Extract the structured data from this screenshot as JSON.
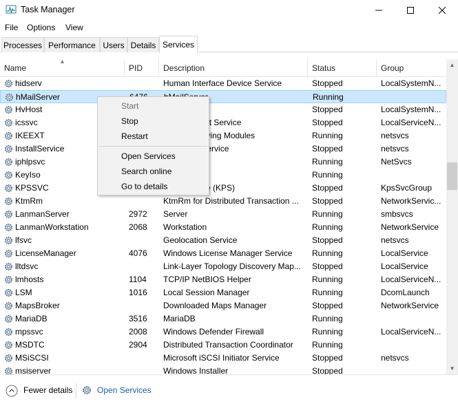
{
  "window": {
    "title": "Task Manager"
  },
  "menu": [
    "File",
    "Options",
    "View"
  ],
  "tabs": [
    "Processes",
    "Performance",
    "Users",
    "Details",
    "Services"
  ],
  "active_tab": "Services",
  "columns": {
    "name": "Name",
    "pid": "PID",
    "description": "Description",
    "status": "Status",
    "group": "Group"
  },
  "rows": [
    {
      "name": "hidserv",
      "pid": "",
      "description": "Human Interface Device Service",
      "status": "Stopped",
      "group": "LocalSystemN..."
    },
    {
      "name": "hMailServer",
      "pid": "6476",
      "description": "hMailServer",
      "status": "Running",
      "group": ""
    },
    {
      "name": "HvHost",
      "pid": "",
      "description": "vice",
      "status": "Stopped",
      "group": "LocalSystemN..."
    },
    {
      "name": "icssvc",
      "pid": "",
      "description": "obile Hotspot Service",
      "status": "Stopped",
      "group": "LocalServiceN..."
    },
    {
      "name": "IKEEXT",
      "pid": "",
      "description": "IP IPsec Keying Modules",
      "status": "Running",
      "group": "netsvcs"
    },
    {
      "name": "InstallService",
      "pid": "",
      "description": "ore Install Service",
      "status": "Stopped",
      "group": "netsvcs"
    },
    {
      "name": "iphlpsvc",
      "pid": "",
      "description": "",
      "status": "Running",
      "group": "NetSvcs"
    },
    {
      "name": "KeyIso",
      "pid": "",
      "description": "ation",
      "status": "Running",
      "group": ""
    },
    {
      "name": "KPSSVC",
      "pid": "",
      "description": "erver service (KPS)",
      "status": "Stopped",
      "group": "KpsSvcGroup"
    },
    {
      "name": "KtmRm",
      "pid": "",
      "description": "KtmRm for Distributed Transaction ...",
      "status": "Stopped",
      "group": "NetworkServic..."
    },
    {
      "name": "LanmanServer",
      "pid": "2972",
      "description": "Server",
      "status": "Running",
      "group": "smbsvcs"
    },
    {
      "name": "LanmanWorkstation",
      "pid": "2068",
      "description": "Workstation",
      "status": "Running",
      "group": "NetworkService"
    },
    {
      "name": "lfsvc",
      "pid": "",
      "description": "Geolocation Service",
      "status": "Stopped",
      "group": "netsvcs"
    },
    {
      "name": "LicenseManager",
      "pid": "4076",
      "description": "Windows License Manager Service",
      "status": "Running",
      "group": "LocalService"
    },
    {
      "name": "lltdsvc",
      "pid": "",
      "description": "Link-Layer Topology Discovery Map...",
      "status": "Stopped",
      "group": "LocalService"
    },
    {
      "name": "lmhosts",
      "pid": "1104",
      "description": "TCP/IP NetBIOS Helper",
      "status": "Running",
      "group": "LocalServiceN..."
    },
    {
      "name": "LSM",
      "pid": "1016",
      "description": "Local Session Manager",
      "status": "Running",
      "group": "DcomLaunch"
    },
    {
      "name": "MapsBroker",
      "pid": "",
      "description": "Downloaded Maps Manager",
      "status": "Stopped",
      "group": "NetworkService"
    },
    {
      "name": "MariaDB",
      "pid": "3516",
      "description": "MariaDB",
      "status": "Running",
      "group": ""
    },
    {
      "name": "mpssvc",
      "pid": "2008",
      "description": "Windows Defender Firewall",
      "status": "Running",
      "group": "LocalServiceN..."
    },
    {
      "name": "MSDTC",
      "pid": "2904",
      "description": "Distributed Transaction Coordinator",
      "status": "Running",
      "group": ""
    },
    {
      "name": "MSiSCSI",
      "pid": "",
      "description": "Microsoft iSCSI Initiator Service",
      "status": "Stopped",
      "group": "netsvcs"
    },
    {
      "name": "msiserver",
      "pid": "",
      "description": "Windows Installer",
      "status": "Stopped",
      "group": ""
    }
  ],
  "selected_row": 1,
  "context_menu": {
    "start": "Start",
    "stop": "Stop",
    "restart": "Restart",
    "open_services": "Open Services",
    "search_online": "Search online",
    "go_to_details": "Go to details"
  },
  "footer": {
    "fewer_details": "Fewer details",
    "open_services": "Open Services"
  },
  "colors": {
    "selection": "#cce8ff",
    "selection_border": "#99d1ff",
    "link": "#1a5fb4",
    "disabled": "#6d6d6d"
  }
}
